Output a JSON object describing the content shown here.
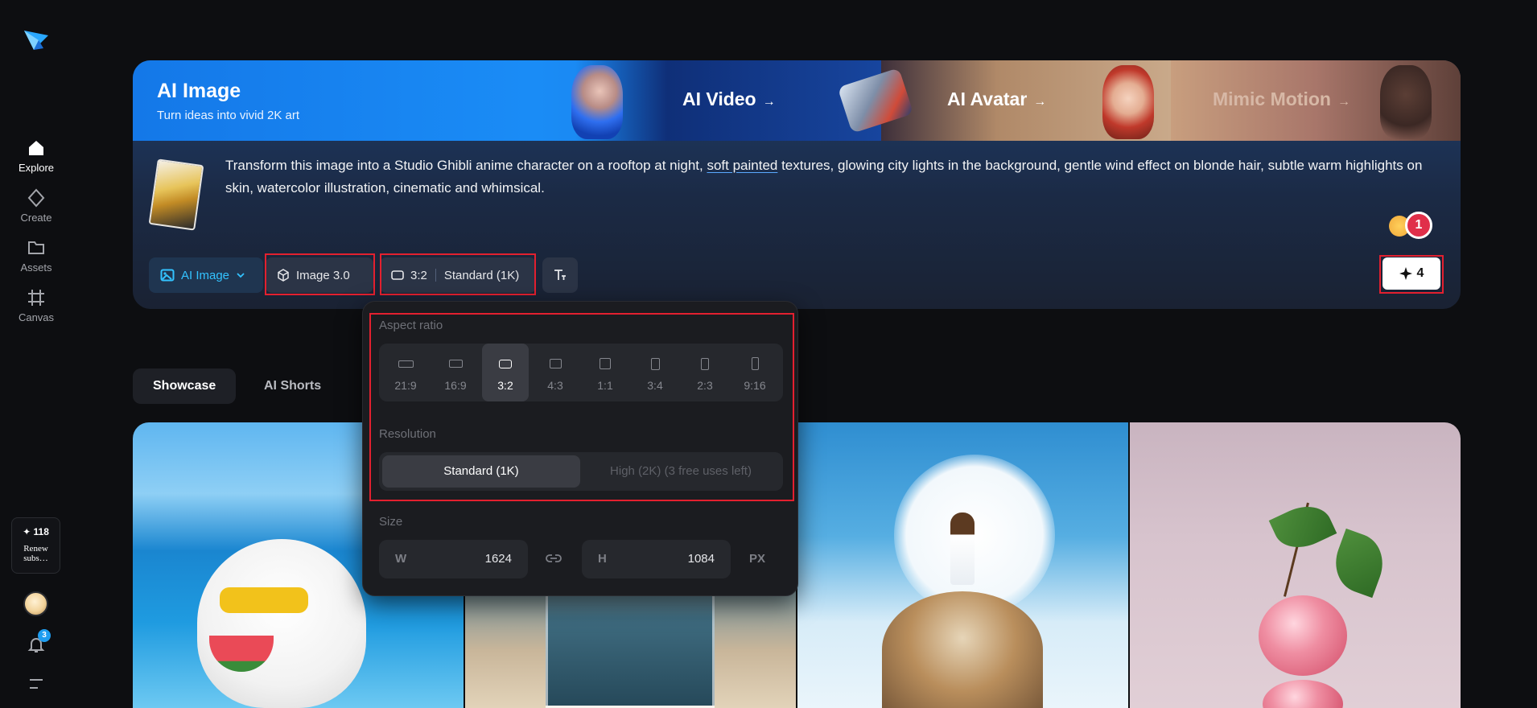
{
  "sidebar": {
    "items": [
      {
        "label": "Explore",
        "icon": "home-icon",
        "active": true
      },
      {
        "label": "Create",
        "icon": "diamond-icon",
        "active": false
      },
      {
        "label": "Assets",
        "icon": "folder-icon",
        "active": false
      },
      {
        "label": "Canvas",
        "icon": "canvas-grid-icon",
        "active": false
      }
    ],
    "credits": "✦ 118",
    "renew": "Renew subs…",
    "notification_count": "3"
  },
  "hero": {
    "title": "AI Image",
    "subtitle": "Turn ideas into vivid 2K art",
    "promos": [
      {
        "label": "AI Video",
        "arrow": "→"
      },
      {
        "label": "AI Avatar",
        "arrow": "→"
      },
      {
        "label": "Mimic Motion",
        "arrow": "→"
      }
    ],
    "prompt": {
      "before": "Transform this image into a Studio Ghibli anime character on a rooftop at night, ",
      "highlight": "soft painted",
      "after": " textures, glowing city lights in the background, gentle wind effect on blonde hair, subtle warm highlights on skin, watercolor illustration, cinematic and whimsical."
    },
    "reaction_count": "1"
  },
  "toolbar": {
    "mode": "AI Image",
    "model": "Image 3.0",
    "ratio": "3:2",
    "resolution": "Standard (1K)",
    "generate_label": "4",
    "generate_icon": "sparkle-icon"
  },
  "tabs": [
    {
      "label": "Showcase",
      "active": true
    },
    {
      "label": "AI Shorts",
      "active": false
    }
  ],
  "dropdown": {
    "aspect_label": "Aspect ratio",
    "ratios": [
      {
        "label": "21:9",
        "selected": false
      },
      {
        "label": "16:9",
        "selected": false
      },
      {
        "label": "3:2",
        "selected": true
      },
      {
        "label": "4:3",
        "selected": false
      },
      {
        "label": "1:1",
        "selected": false
      },
      {
        "label": "3:4",
        "selected": false
      },
      {
        "label": "2:3",
        "selected": false
      },
      {
        "label": "9:16",
        "selected": false
      }
    ],
    "resolution_label": "Resolution",
    "res_standard": "Standard (1K)",
    "res_high": "High (2K)  (3 free uses left)",
    "size_label": "Size",
    "width_label": "W",
    "width_value": "1624",
    "height_label": "H",
    "height_value": "1084",
    "unit": "PX"
  },
  "colors": {
    "accent": "#33c3ff",
    "highlight_box": "#e3202f",
    "badge": "#1e9df0"
  }
}
